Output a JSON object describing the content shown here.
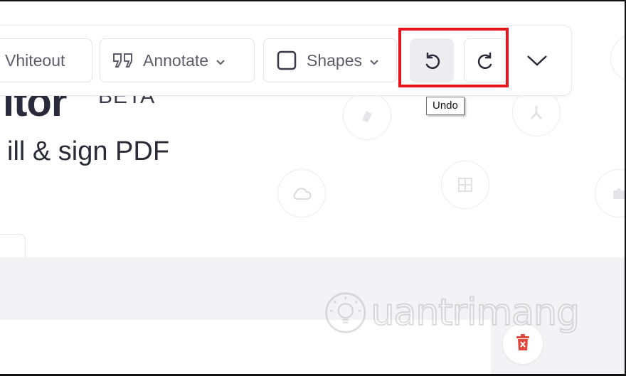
{
  "heading": {
    "title": "itor",
    "badge": "BETA",
    "subtitle": "ill & sign PDF"
  },
  "toolbar": {
    "whiteout_label": "Vhiteout",
    "annotate_label": "Annotate",
    "shapes_label": "Shapes"
  },
  "tooltip": {
    "text": "Undo"
  },
  "watermark": {
    "text": "uantrimang"
  },
  "icons": {
    "annotate": "quote-icon",
    "shapes": "square-icon",
    "undo": "undo-icon",
    "redo": "redo-icon",
    "more": "chevron-down-icon",
    "delete": "trash-icon"
  },
  "colors": {
    "highlight": "#e8141c",
    "danger": "#e0483e",
    "text": "#2a2a3a"
  }
}
